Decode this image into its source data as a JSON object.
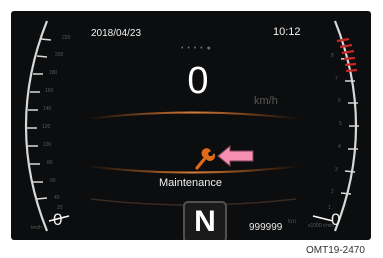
{
  "status": {
    "date": "2018/04/23",
    "time": "10:12",
    "page_dots": "• • • • ●"
  },
  "speedometer": {
    "value": "0",
    "unit": "km/h",
    "zero": "0",
    "unit_small": "km/h",
    "scale": [
      "220",
      "200",
      "180",
      "160",
      "140",
      "120",
      "100",
      "80",
      "60",
      "40",
      "20"
    ]
  },
  "tachometer": {
    "zero": "0",
    "unit_small": "x1000 r/min",
    "scale": [
      "8",
      "7",
      "6",
      "5",
      "4",
      "3",
      "2",
      "1"
    ]
  },
  "warning": {
    "label": "Maintenance",
    "icon": "wrench-icon"
  },
  "gear": {
    "position": "N"
  },
  "odometer": {
    "value": "999999",
    "unit": "km"
  },
  "caption": "OMT19-2470",
  "colors": {
    "background": "#0c0d0e",
    "accent_orange": "#e06a18",
    "redline": "#c62828",
    "pointer_pink": "#f48fb1"
  }
}
